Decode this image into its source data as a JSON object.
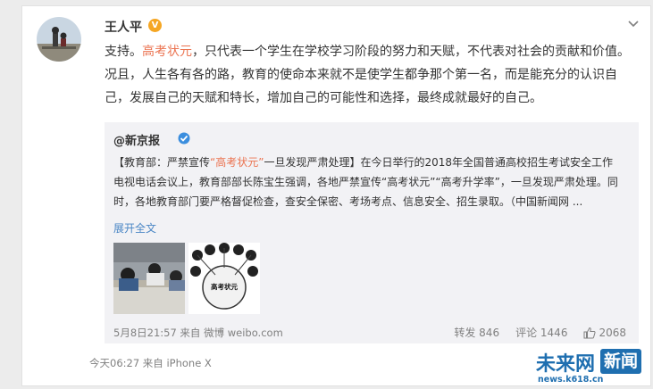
{
  "post": {
    "author": "王人平",
    "verified_badge": "V",
    "text_prefix": "支持。",
    "hashtag": "高考状元",
    "text_rest": "，只代表一个学生在学校学习阶段的努力和天赋，不代表对社会的贡献和价值。况且，人生各有各的路，教育的使命本来就不是使学生都争那个第一名，而是能充分的认识自己，发展自己的天赋和特长，增加自己的可能性和选择，最终成就最好的自己。",
    "footer": "今天06:27 来自 iPhone X"
  },
  "quoted": {
    "author": "@新京报",
    "bracket_open": "【教育部：严禁宣传",
    "hashtag": "“高考状元”",
    "bracket_close": "一旦发现严肃处理】",
    "body": "在今日举行的2018年全国普通高校招生考试安全工作电视电话会议上，教育部部长陈宝生强调，各地严禁宣传“高考状元”“高考升学率”，一旦发现严肃处理。同时，各地教育部门要严格督促检查，查安全保密、考场考点、信息安全、招生录取。（中国新闻网 ...",
    "expand": "展开全文",
    "image2_caption": "高考状元",
    "time": "5月8日21:57 来自 微博 weibo.com",
    "reposts": "转发 846",
    "comments": "评论 1446",
    "likes": "2068"
  },
  "watermark": {
    "main": "未来网",
    "box": "新闻",
    "url": "news.k618.cn"
  },
  "colors": {
    "hashtag": "#eb7350",
    "link": "#4a86c5",
    "brand": "#1f6fb0"
  }
}
